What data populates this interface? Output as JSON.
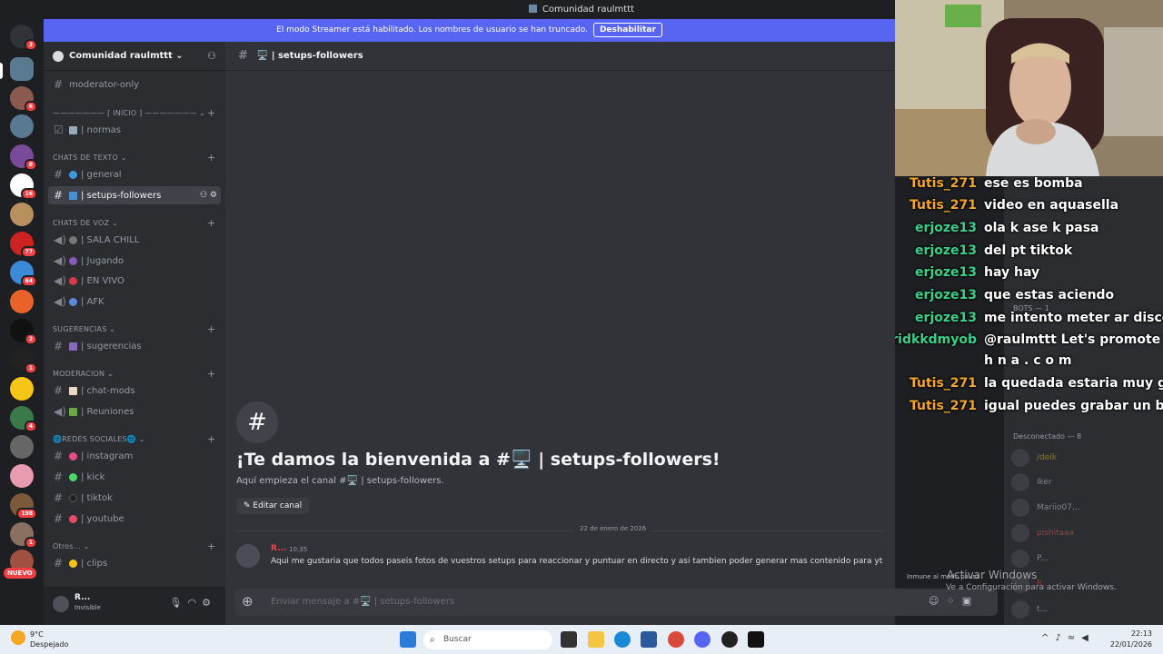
{
  "window": {
    "title": "Comunidad raulmttt"
  },
  "banner": {
    "text": "El modo Streamer está habilitado. Los nombres de usuario se han truncado.",
    "button": "Deshabilitar"
  },
  "server": {
    "name": "Comunidad raulmttt ⌄"
  },
  "guild_badges": [
    "3",
    "6",
    "8",
    "16",
    "77",
    "64",
    "2",
    "1",
    "4",
    "198",
    "1"
  ],
  "guild_nuevo": "NUEVO",
  "categories": {
    "inicio": "——————— [ INICIO ] ——————— ⌄",
    "texto": "CHATS DE TEXTO ⌄",
    "voz": "CHATS DE VOZ ⌄",
    "sugerencias": "SUGERENCIAS ⌄",
    "moderacion": "MODERACION ⌄",
    "redes": "🌐REDES SOCIALES🌐 ⌄",
    "otros": "Otros... ⌄"
  },
  "channels": {
    "moderator": "moderator-only",
    "normas": "| normas",
    "general": "| general",
    "setups": "| setups-followers",
    "sala": "| SALA CHILL",
    "jugando": "| Jugando",
    "envivo": "| EN VIVO",
    "afk": "| AFK",
    "sugerencias": "| sugerencias",
    "chatmods": "| chat-mods",
    "reuniones": "| Reuniones",
    "instagram": "| instagram",
    "kick": "| kick",
    "tiktok": "| tiktok",
    "youtube": "| youtube",
    "clips": "| clips"
  },
  "user": {
    "name": "R...",
    "status": "Invisible"
  },
  "header": {
    "channel": "🖥️ | setups-followers"
  },
  "welcome": {
    "title": "¡Te damos la bienvenida a #🖥️ | setups-followers!",
    "subtitle": "Aquí empieza el canal #🖥️ | setups-followers.",
    "edit": "✎ Editar canal"
  },
  "date_divider": "22 de enero de 2026",
  "message": {
    "author": "R...",
    "time": "10:35",
    "text": "Aqui me gustaria que todos paseis fotos de vuestros setups para reaccionar y puntuar en directo y asi tambien poder generar mas contenido para yt"
  },
  "composer": {
    "placeholder": "Enviar mensaje a #🖥️ | setups-followers"
  },
  "members": {
    "offline_header": "Desconectado — 8",
    "bots_header": "BOTS — 1",
    "list": [
      "/deik",
      "iker",
      "Mariio07...",
      "pishitaaa",
      "P...",
      "R...",
      "t..."
    ]
  },
  "immune": "Inmune al modo pausa",
  "watermark": {
    "line1": "Activar Windows",
    "line2": "Ve a Configuración para activar Windows."
  },
  "chat": [
    {
      "user": "Tutis_271",
      "text": "ese es bomba",
      "color": "#f5a623"
    },
    {
      "user": "Tutis_271",
      "text": "video en aquasella",
      "color": "#f5a623"
    },
    {
      "user": "erjoze13",
      "text": "ola k ase k pasa",
      "color": "#3ad28b"
    },
    {
      "user": "erjoze13",
      "text": "del pt tiktok",
      "color": "#3ad28b"
    },
    {
      "user": "erjoze13",
      "text": "hay hay",
      "color": "#3ad28b"
    },
    {
      "user": "erjoze13",
      "text": "que estas aciendo",
      "color": "#3ad28b"
    },
    {
      "user": "erjoze13",
      "text": "me intento meter ar discord",
      "color": "#3ad28b"
    },
    {
      "user": "endemichybridkkdmyob",
      "text": "@raulmttt Let's promote you",
      "color": "#3ad28b"
    },
    {
      "user": "",
      "text": "h n a . c o m",
      "color": "#3ad28b"
    },
    {
      "user": "Tutis_271",
      "text": "la quedada estaria muy guap",
      "color": "#f5a623"
    },
    {
      "user": "Tutis_271",
      "text": "igual puedes grabar un blog",
      "color": "#f5a623"
    }
  ],
  "taskbar": {
    "temp": "9°C",
    "weather": "Despejado",
    "search": "Buscar",
    "time": "22:13",
    "date": "22/01/2026"
  }
}
